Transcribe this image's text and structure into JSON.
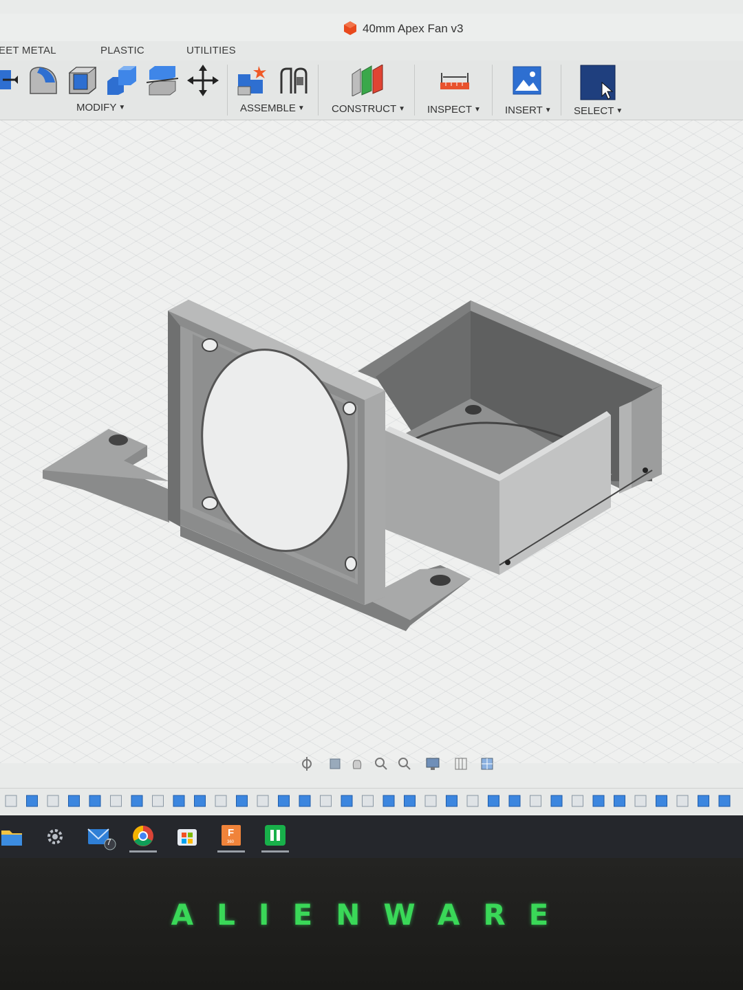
{
  "window": {
    "title": "40mm Apex Fan v3"
  },
  "tabs": [
    {
      "label": "EET METAL"
    },
    {
      "label": "PLASTIC"
    },
    {
      "label": "UTILITIES"
    }
  ],
  "toolbar": {
    "groups": [
      {
        "label": "MODIFY"
      },
      {
        "label": "ASSEMBLE"
      },
      {
        "label": "CONSTRUCT"
      },
      {
        "label": "INSPECT"
      },
      {
        "label": "INSERT"
      },
      {
        "label": "SELECT"
      }
    ]
  },
  "taskbar": {
    "mail_badge": "7",
    "fusion_badge": "F",
    "fusion_sub": "360"
  },
  "bezel": {
    "brand": "ALIENWARE"
  },
  "colors": {
    "accent_blue": "#2e6fd1",
    "brand_green": "#3ad858",
    "model_gray": "#8a8b8b"
  }
}
